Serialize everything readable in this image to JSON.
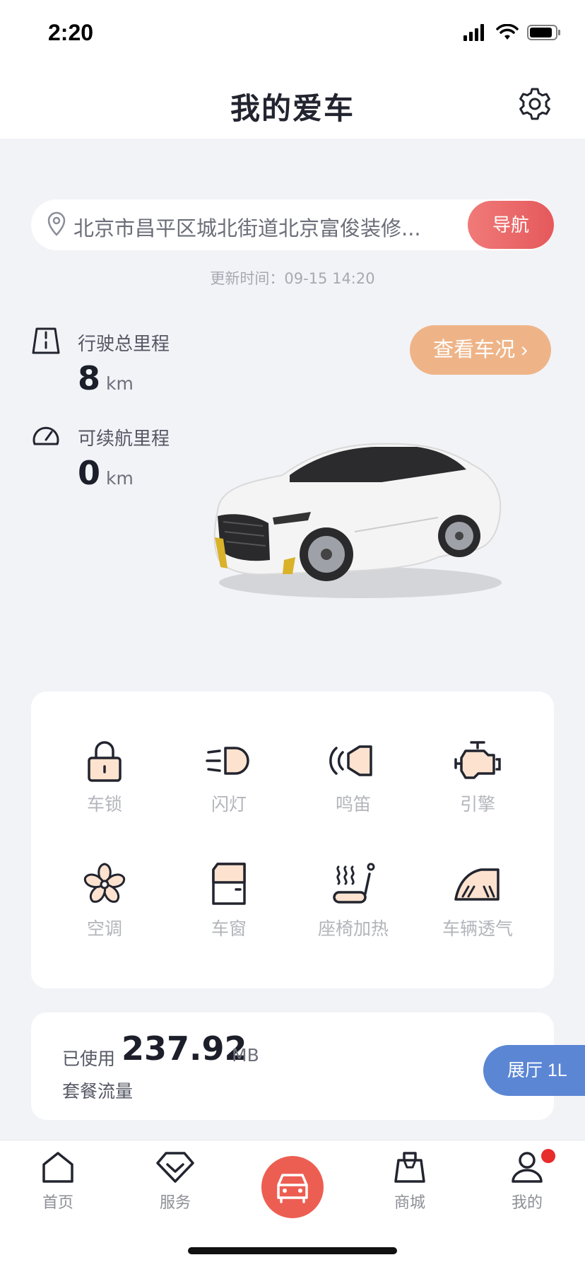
{
  "status_bar": {
    "time": "2:20"
  },
  "header": {
    "title": "我的爱车"
  },
  "location": {
    "address": "北京市昌平区城北街道北京富俊装修...",
    "nav_label": "导航"
  },
  "update": {
    "label": "更新时间：",
    "value": "09-15 14:20"
  },
  "mileage": {
    "total": {
      "label": "行驶总里程",
      "value": "8",
      "unit": "km"
    },
    "range": {
      "label": "可续航里程",
      "value": "0",
      "unit": "km"
    }
  },
  "status_button": {
    "label": "查看车况 ›"
  },
  "controls": [
    {
      "label": "车锁",
      "icon": "lock-icon"
    },
    {
      "label": "闪灯",
      "icon": "headlight-icon"
    },
    {
      "label": "鸣笛",
      "icon": "horn-icon"
    },
    {
      "label": "引擎",
      "icon": "engine-icon"
    },
    {
      "label": "空调",
      "icon": "fan-icon"
    },
    {
      "label": "车窗",
      "icon": "window-icon"
    },
    {
      "label": "座椅加热",
      "icon": "seat-heat-icon"
    },
    {
      "label": "车辆透气",
      "icon": "ventilation-icon"
    }
  ],
  "data_usage": {
    "prefix": "已使用",
    "value": "237.92",
    "unit": "MB",
    "label": "套餐流量"
  },
  "showroom": {
    "label": "展厅 1L"
  },
  "tabs": [
    {
      "label": "首页",
      "icon": "home-icon"
    },
    {
      "label": "服务",
      "icon": "diamond-icon"
    },
    {
      "label": "",
      "icon": "car-icon"
    },
    {
      "label": "商城",
      "icon": "bag-icon"
    },
    {
      "label": "我的",
      "icon": "user-icon"
    }
  ],
  "colors": {
    "accent": "#ed5e52",
    "status_button": "#eeb488",
    "showroom": "#5b86d4",
    "icon_fill": "#fde3cf"
  }
}
